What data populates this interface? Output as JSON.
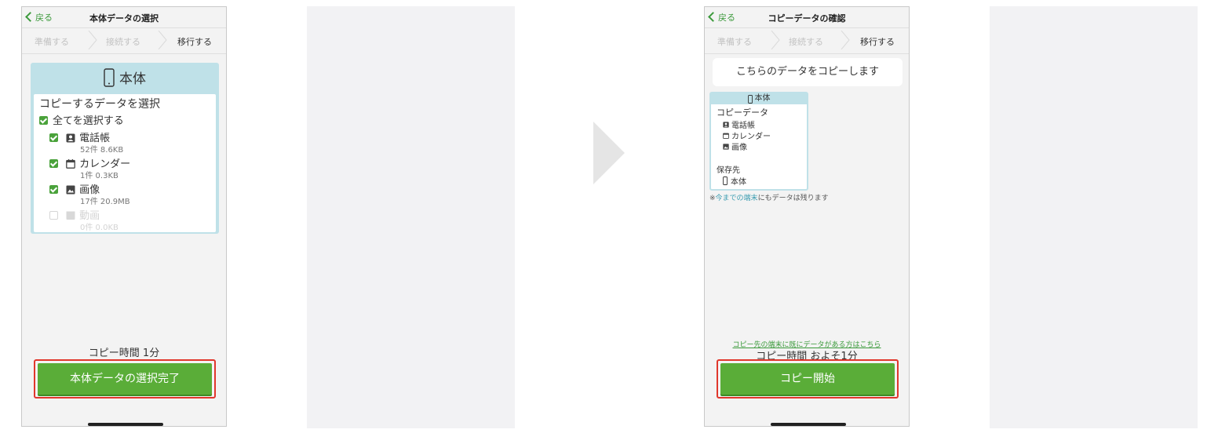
{
  "left": {
    "back_label": "戻る",
    "title": "本体データの選択",
    "steps": [
      "準備する",
      "接続する",
      "移行する"
    ],
    "panel_title": "本体",
    "select_title": "コピーするデータを選択",
    "select_all": "全てを選択する",
    "items": [
      {
        "label": "電話帳",
        "sub": "52件 8.6KB",
        "checked": true,
        "icon": "contact-icon"
      },
      {
        "label": "カレンダー",
        "sub": "1件 0.3KB",
        "checked": true,
        "icon": "calendar-icon"
      },
      {
        "label": "画像",
        "sub": "17件 20.9MB",
        "checked": true,
        "icon": "image-icon"
      },
      {
        "label": "動画",
        "sub": "0件 0.0KB",
        "checked": false,
        "icon": "video-icon"
      }
    ],
    "copy_time": "コピー時間 1分",
    "button": "本体データの選択完了"
  },
  "right": {
    "back_label": "戻る",
    "title": "コピーデータの確認",
    "steps": [
      "準備する",
      "接続する",
      "移行する"
    ],
    "confirm": "こちらのデータをコピーします",
    "mini_title": "本体",
    "copy_data_label": "コピーデータ",
    "copy_items": [
      "電話帳",
      "カレンダー",
      "画像"
    ],
    "dest_label": "保存先",
    "dest": "本体",
    "note_prefix": "※",
    "note_highlight": "今までの端末",
    "note_suffix": "にもデータは残ります",
    "link": "コピー先の端末に既にデータがある方はこちら",
    "copy_time": "コピー時間 およそ1分",
    "button": "コピー開始"
  },
  "colors": {
    "accent_green": "#5aad38",
    "outline_red": "#e0372c",
    "panel_blue": "#bfe1e8"
  }
}
